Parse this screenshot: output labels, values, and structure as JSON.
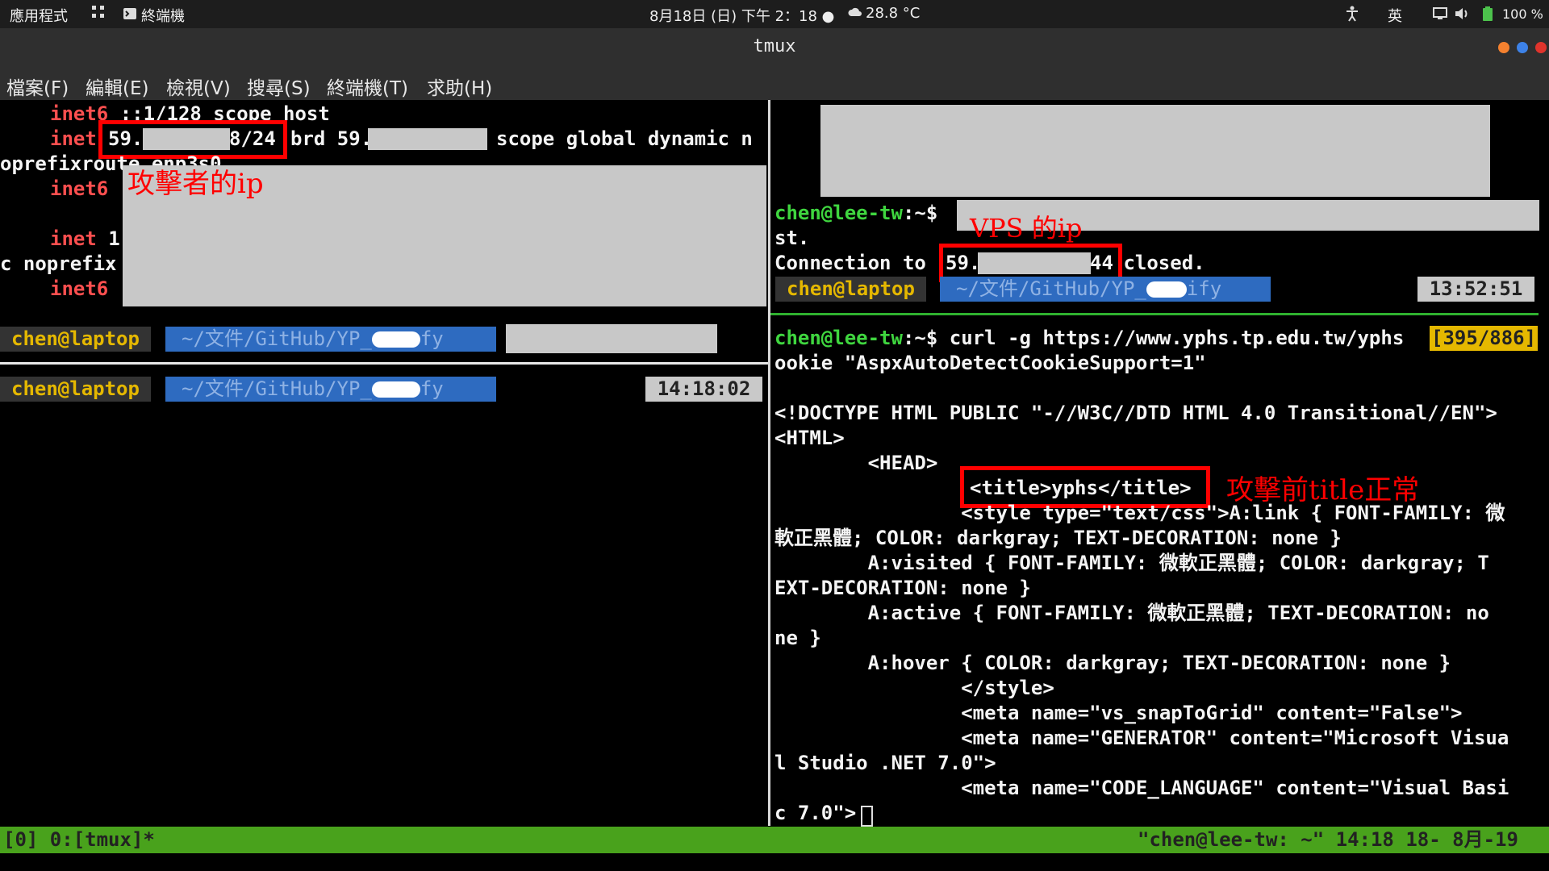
{
  "topbar": {
    "apps": "應用程式",
    "terminal": "終端機",
    "datetime": "8月18日 (日) 下午 2：18 ●",
    "weather": "28.8 °C",
    "ime": "英",
    "battery": "100 %"
  },
  "window": {
    "title": "tmux"
  },
  "menu": [
    "檔案(F)",
    "編輯(E)",
    "檢視(V)",
    "搜尋(S)",
    "終端機(T)",
    "求助(H)"
  ],
  "left_pane": {
    "line1_kw": "inet6",
    "line1_rest": " ::1/128 scope host",
    "line2_kw": "inet",
    "ip_prefix": "59.",
    "ip_suffix": "8/24",
    "line2_rest": "brd 59.",
    "line2_tail": "scope global dynamic n",
    "line3": "oprefixroute enp3s0",
    "line4_kw": "inet6",
    "line5_kw": "inet",
    "line5_rest": " 1",
    "line6": "c noprefix",
    "line7_kw": "inet6",
    "annotation_attacker": "攻擊者的ip",
    "prompt1_user": "chen@laptop",
    "prompt1_path": "~/文件/GitHub/YP_",
    "prompt1_suffix": "fy",
    "prompt2_user": "chen@laptop",
    "prompt2_path": "~/文件/GitHub/YP_",
    "prompt2_suffix": "fy",
    "prompt2_time": "14:18:02"
  },
  "right_top": {
    "prompt_user": "chen@lee-tw",
    "prompt_sep": ":~$",
    "line_st": "st.",
    "conn_pre": "Connection to ",
    "conn_ip_prefix": "59.",
    "conn_ip_suffix": "44",
    "conn_post": " closed.",
    "annotation_vps": "VPS 的ip",
    "pl_user": "chen@laptop",
    "pl_path": "~/文件/GitHub/YP_",
    "pl_suffix": "ify",
    "pl_time": "13:52:51"
  },
  "right_bottom": {
    "prompt_user": "chen@lee-tw",
    "prompt_sep": ":~$",
    "cmd": " curl -g https://www.yphs.tp.edu.tw/yphs",
    "counter": "[395/886]",
    "l2": "ookie \"AspxAutoDetectCookieSupport=1\"",
    "l3": "<!DOCTYPE HTML PUBLIC \"-//W3C//DTD HTML 4.0 Transitional//EN\">",
    "l4": "<HTML>",
    "l5": "        <HEAD>",
    "l6": "<title>yphs</title>",
    "annotation_title": "攻擊前title正常",
    "l7": "                <style type=\"text/css\">A:link { FONT-FAMILY: 微",
    "l8": "軟正黑體; COLOR: darkgray; TEXT-DECORATION: none }",
    "l9": "        A:visited { FONT-FAMILY: 微軟正黑體; COLOR: darkgray; T",
    "l10": "EXT-DECORATION: none }",
    "l11": "        A:active { FONT-FAMILY: 微軟正黑體; TEXT-DECORATION: no",
    "l12": "ne }",
    "l13": "        A:hover { COLOR: darkgray; TEXT-DECORATION: none }",
    "l14": "                </style>",
    "l15": "                <meta name=\"vs_snapToGrid\" content=\"False\">",
    "l16": "                <meta name=\"GENERATOR\" content=\"Microsoft Visua",
    "l17": "l Studio .NET 7.0\">",
    "l18": "                <meta name=\"CODE_LANGUAGE\" content=\"Visual Basi",
    "l19": "c 7.0\">"
  },
  "status": {
    "left": "[0] 0:[tmux]*",
    "right": "\"chen@lee-tw: ~\" 14:18 18- 8月-19"
  },
  "colors": {
    "status_green": "#49a21c",
    "annotation_red": "#ff0000",
    "prompt_green": "#3fd63f",
    "powerline_blue": "#2e6bc0"
  }
}
